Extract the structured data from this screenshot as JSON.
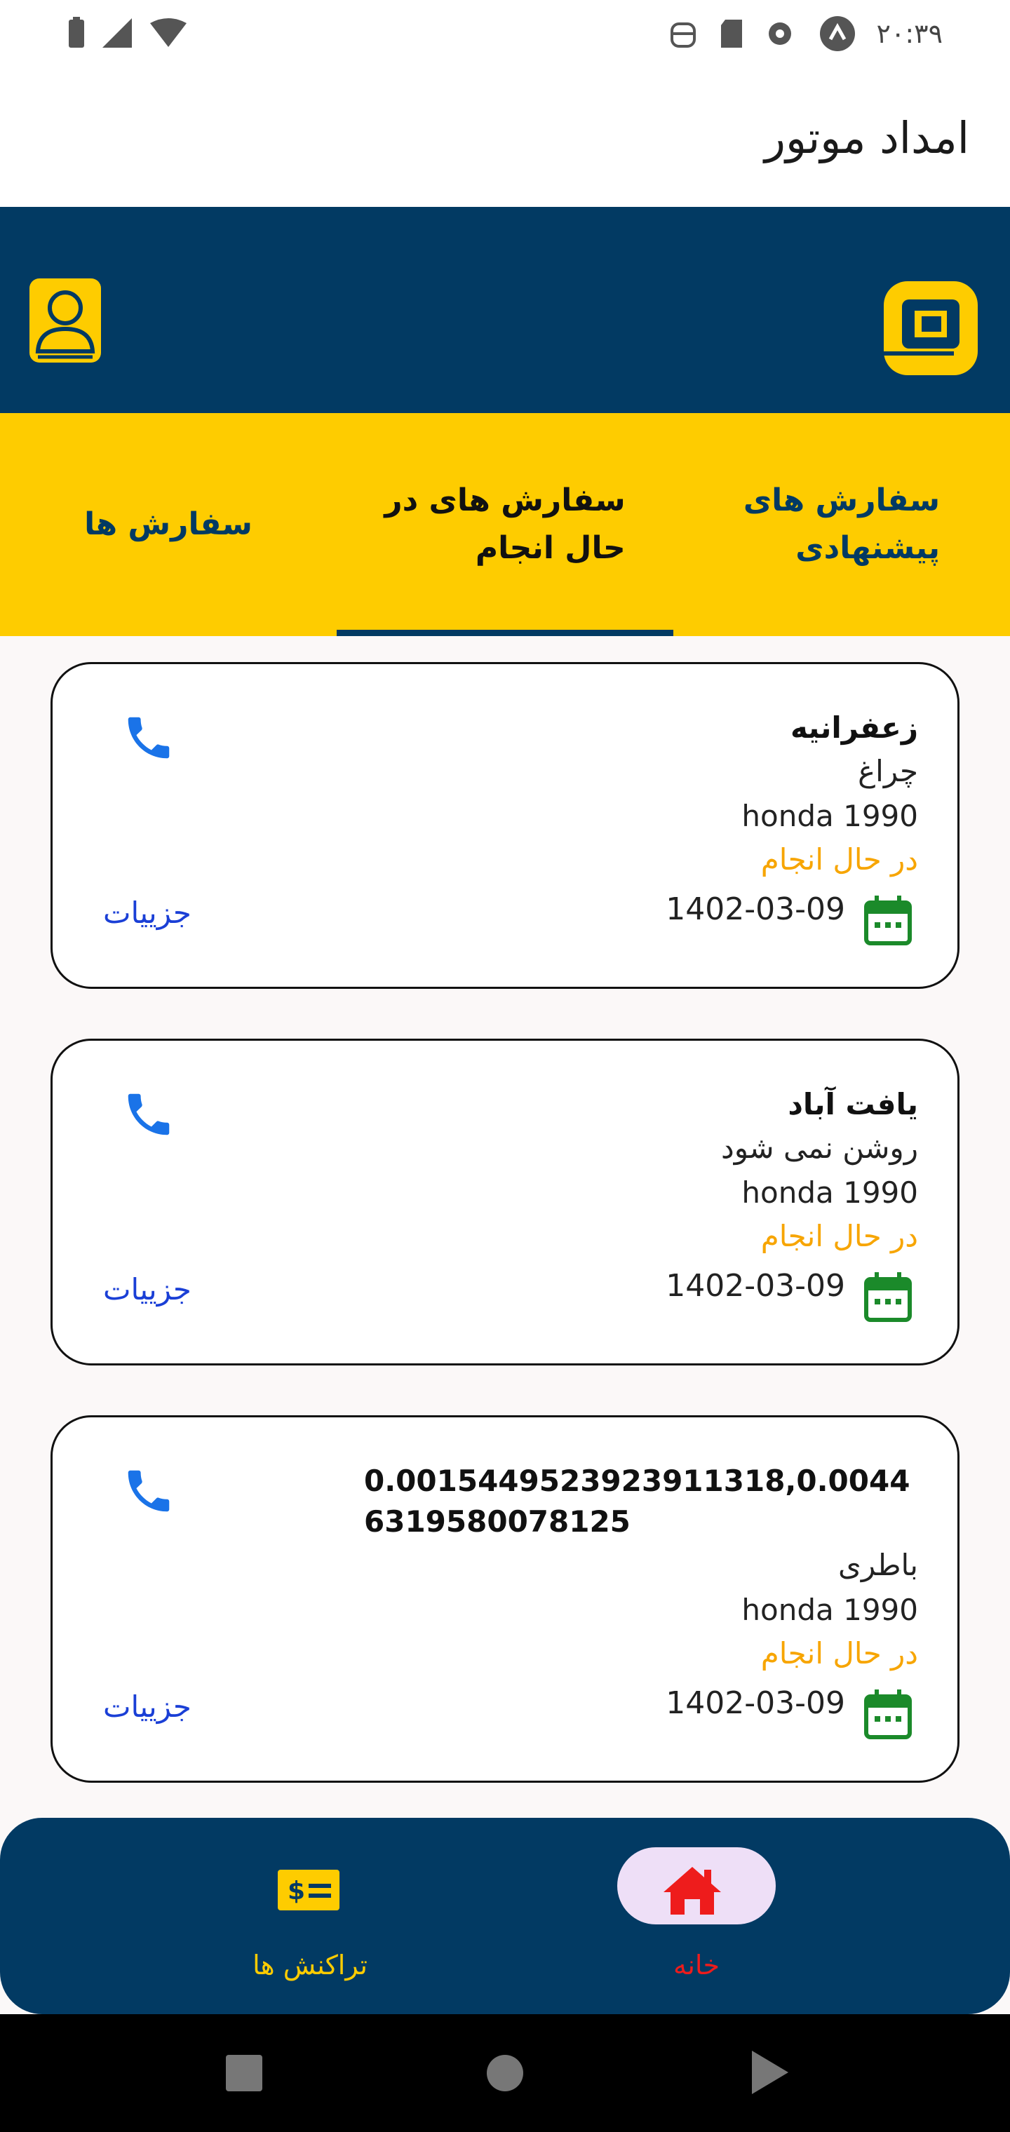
{
  "status_bar": {
    "time": "۲۰:۳۹",
    "icons": [
      "battery-icon",
      "signal-icon",
      "wifi-icon",
      "android-icon",
      "sd-card-icon",
      "sync-icon",
      "notification-badge-icon"
    ]
  },
  "app_bar": {
    "title": "امداد موتور"
  },
  "tabs": [
    {
      "label_line1": "سفارش های",
      "label_line2": "پیشنهادی"
    },
    {
      "label_line1": "سفارش های در",
      "label_line2": "حال انجام"
    },
    {
      "label_line1": "سفارش ها",
      "label_line2": ""
    }
  ],
  "orders": [
    {
      "title": "زعفرانیه",
      "problem": "چراغ",
      "model": "honda 1990",
      "status": "در حال انجام",
      "date": "1402-03-09",
      "details": "جزییات"
    },
    {
      "title": "یافت آباد",
      "problem": "روشن نمی شود",
      "model": "honda 1990",
      "status": "در حال انجام",
      "date": "1402-03-09",
      "details": "جزییات"
    },
    {
      "title": "0.0015449523923911318,0.00446319580078125",
      "problem": "باطری",
      "model": "honda 1990",
      "status": "در حال انجام",
      "date": "1402-03-09",
      "details": "جزییات"
    }
  ],
  "bottom_nav": {
    "home_label": "خانه",
    "transactions_label": "تراکنش ها",
    "home_icon": "home-icon",
    "transactions_icon": "money-card-icon"
  },
  "colors": {
    "navy": "#023a63",
    "yellow": "#fecc00",
    "status_orange": "#f7a500",
    "link_blue": "#1a3fd6",
    "phone_blue": "#1a73e8",
    "calendar_green": "#1b8a2a",
    "home_red": "#ee1c1c"
  }
}
